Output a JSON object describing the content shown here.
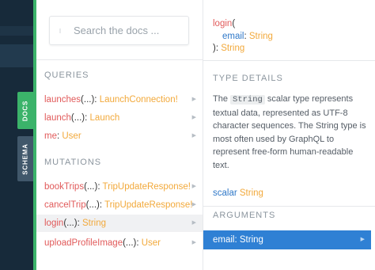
{
  "sidebar": {
    "tabs": [
      {
        "label": "DOCS",
        "active": true
      },
      {
        "label": "SCHEMA",
        "active": false
      }
    ]
  },
  "search": {
    "placeholder": "Search the docs ..."
  },
  "queries": {
    "title": "QUERIES",
    "fields": [
      {
        "name": "launches",
        "args": "(...)",
        "sep": ": ",
        "type": "LaunchConnection!"
      },
      {
        "name": "launch",
        "args": "(...)",
        "sep": ": ",
        "type": "Launch"
      },
      {
        "name": "me",
        "args": "",
        "sep": ": ",
        "type": "User"
      }
    ]
  },
  "mutations": {
    "title": "MUTATIONS",
    "fields": [
      {
        "name": "bookTrips",
        "args": "(...)",
        "sep": ": ",
        "type": "TripUpdateResponse!"
      },
      {
        "name": "cancelTrip",
        "args": "(...)",
        "sep": ": ",
        "type": "TripUpdateResponse!"
      },
      {
        "name": "login",
        "args": "(...)",
        "sep": ": ",
        "type": "String",
        "active": true
      },
      {
        "name": "uploadProfileImage",
        "args": "(...)",
        "sep": ": ",
        "type": "User"
      }
    ]
  },
  "detail": {
    "signature": {
      "name": "login",
      "open": "(",
      "arg_name": "email",
      "arg_sep": ": ",
      "arg_type": "String",
      "close": "): ",
      "return_type": "String"
    },
    "type_details_title": "TYPE DETAILS",
    "desc_pre": "The ",
    "desc_code": "String",
    "desc_post": " scalar type represents textual data, represented as UTF-8 character sequences. The String type is most often used by GraphQL to represent free-form human-readable text.",
    "scalar_keyword": "scalar",
    "scalar_name": "String",
    "arguments_title": "ARGUMENTS",
    "argument": {
      "name": "email",
      "sep": ": ",
      "type": "String"
    }
  },
  "colors": {
    "accent_green": "#3bb36a",
    "field_red": "#e15a5a",
    "type_orange": "#f2a93b",
    "keyword_blue": "#2f78c8",
    "selected_blue": "#2f80d4"
  }
}
